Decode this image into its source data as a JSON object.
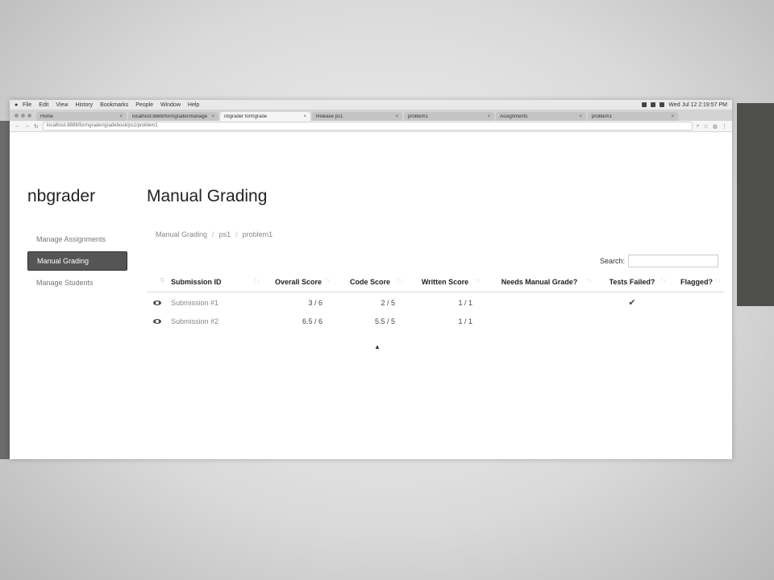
{
  "menubar": {
    "items": [
      "File",
      "Edit",
      "View",
      "History",
      "Bookmarks",
      "People",
      "Window",
      "Help"
    ],
    "clock": "Wed Jul 12  2:19:57 PM"
  },
  "browser": {
    "tabs": [
      {
        "label": "Home",
        "active": false
      },
      {
        "label": "localhost:8888/formgrader/manage",
        "active": false
      },
      {
        "label": "nbgrader formgrade",
        "active": true
      },
      {
        "label": "Release ps1",
        "active": false
      },
      {
        "label": "problem1",
        "active": false
      },
      {
        "label": "Assignments",
        "active": false
      },
      {
        "label": "problem1",
        "active": false
      }
    ],
    "url": "localhost:8888/formgrader/gradebook/ps1/problem1"
  },
  "brand": "nbgrader",
  "page_title": "Manual Grading",
  "sidebar": {
    "items": [
      {
        "label": "Manage Assignments",
        "active": false
      },
      {
        "label": "Manual Grading",
        "active": true
      },
      {
        "label": "Manage Students",
        "active": false
      }
    ]
  },
  "breadcrumb": [
    "Manual Grading",
    "ps1",
    "problem1"
  ],
  "search": {
    "label": "Search:",
    "value": ""
  },
  "table": {
    "columns": [
      "Submission ID",
      "Overall Score",
      "Code Score",
      "Written Score",
      "Needs Manual Grade?",
      "Tests Failed?",
      "Flagged?"
    ],
    "rows": [
      {
        "id": "Submission #1",
        "overall": "3 / 6",
        "code": "2 / 5",
        "written": "1 / 1",
        "needs_manual": "",
        "tests_failed": "✔",
        "flagged": ""
      },
      {
        "id": "Submission #2",
        "overall": "6.5 / 6",
        "code": "5.5 / 5",
        "written": "1 / 1",
        "needs_manual": "",
        "tests_failed": "",
        "flagged": ""
      }
    ]
  },
  "icons": {
    "view": "eye-icon",
    "sort": "sort-arrows-icon",
    "check": "checkmark-icon"
  }
}
